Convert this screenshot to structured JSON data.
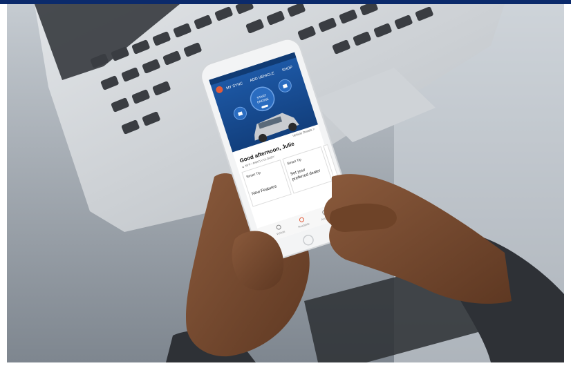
{
  "app": {
    "tabs": [
      "MY SYNC",
      "ADD VEHICLE",
      "SHOP"
    ],
    "start_button": [
      "START",
      "ENGINE"
    ],
    "vehicle_details_link": "Vehicle Details >",
    "greeting": "Good afternoon, Julie",
    "subline": "▲ 49°F • PARTLY CLOUDY",
    "cards": [
      {
        "title": "Smart Tip",
        "body": "New Features"
      },
      {
        "title": "Smart Tip",
        "body": "Set your preferred dealer"
      },
      {
        "title": "Sm",
        "body": ""
      }
    ],
    "nav": [
      "Vehicle",
      "Roadside",
      "Account"
    ]
  },
  "colors": {
    "brand_blue": "#0b2a6b",
    "app_blue": "#1e5aa8",
    "app_blue_dark": "#123f7d"
  }
}
